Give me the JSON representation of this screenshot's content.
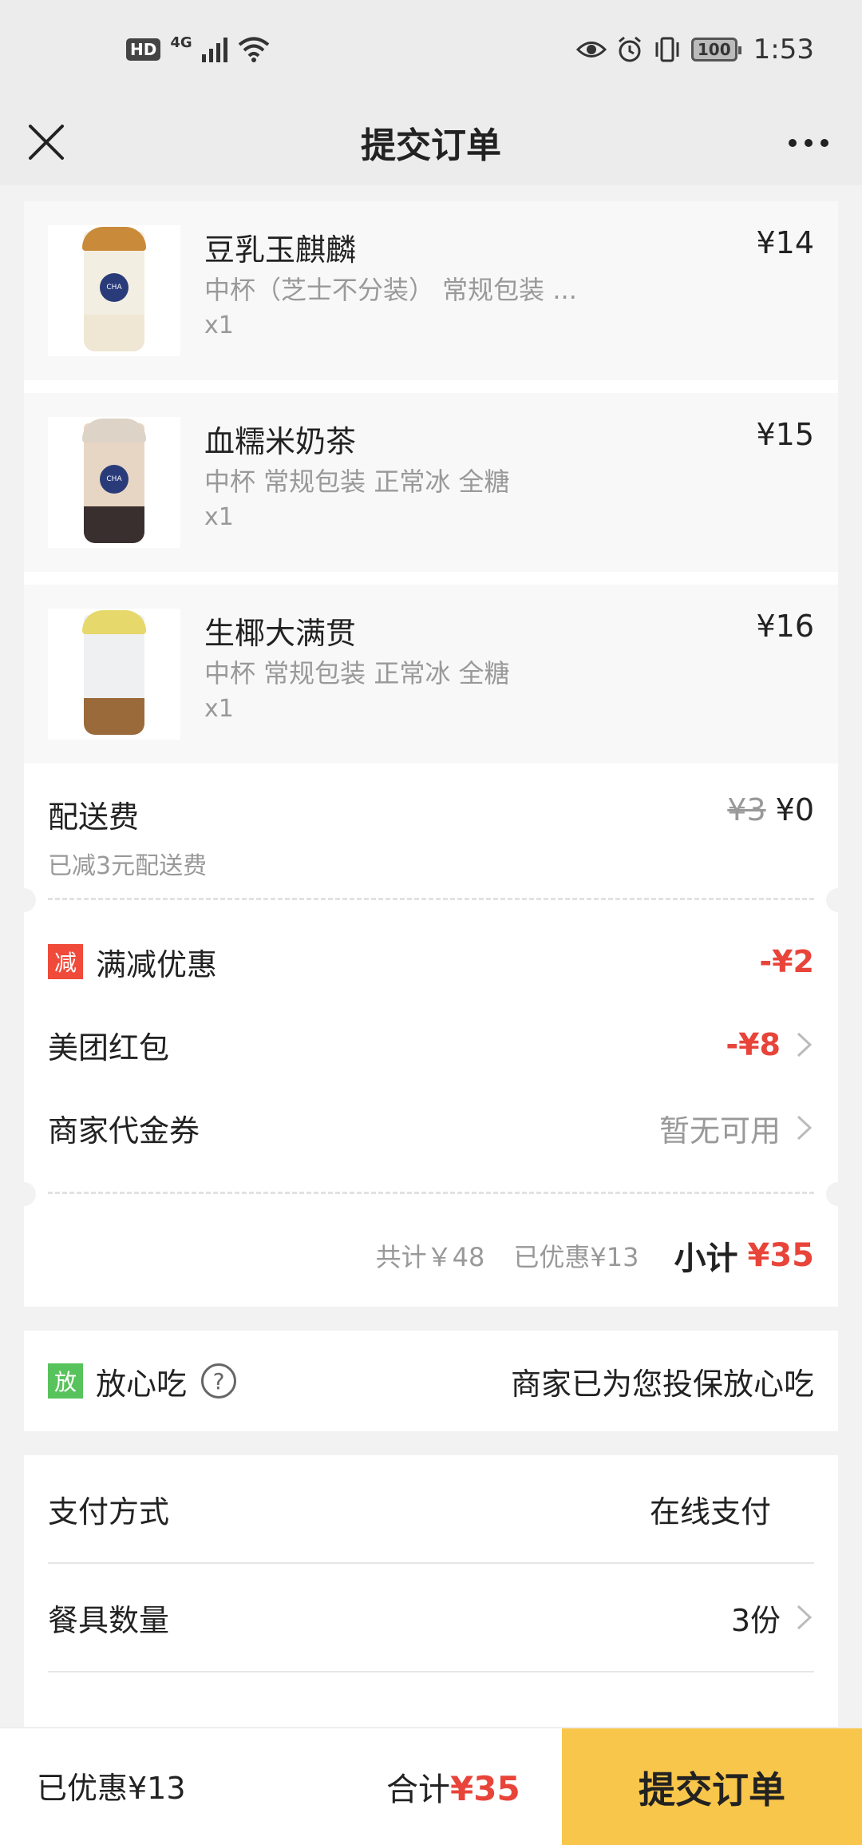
{
  "status_bar": {
    "hd": "HD",
    "network": "4G",
    "battery": "100",
    "time": "1:53",
    "icons": [
      "signal-icon",
      "wifi-icon",
      "eye-icon",
      "alarm-icon",
      "vibrate-icon",
      "battery-icon"
    ]
  },
  "nav": {
    "title": "提交订单",
    "close_icon": "close-icon",
    "more_icon": "more-icon"
  },
  "products": [
    {
      "name": "豆乳玉麒麟",
      "spec": "中杯（芝士不分装） 常规包装 ...",
      "qty": "x1",
      "price": "¥14"
    },
    {
      "name": "血糯米奶茶",
      "spec": "中杯 常规包装 正常冰 全糖",
      "qty": "x1",
      "price": "¥15"
    },
    {
      "name": "生椰大满贯",
      "spec": "中杯 常规包装 正常冰 全糖",
      "qty": "x1",
      "price": "¥16"
    }
  ],
  "delivery": {
    "label": "配送费",
    "sub": "已减3元配送费",
    "original": "¥3",
    "price": "¥0"
  },
  "discounts": {
    "full_reduction": {
      "tag": "减",
      "label": "满减优惠",
      "amount": "-¥2"
    },
    "red_packet": {
      "label": "美团红包",
      "amount": "-¥8"
    },
    "voucher": {
      "label": "商家代金券",
      "value": "暂无可用"
    }
  },
  "subtotal": {
    "total": "共计￥48",
    "saved": "已优惠¥13",
    "label": "小计",
    "amount": "¥35"
  },
  "safe_eat": {
    "tag": "放",
    "label": "放心吃",
    "help": "?",
    "note": "商家已为您投保放心吃"
  },
  "payment": {
    "method_label": "支付方式",
    "method_value": "在线支付",
    "utensils_label": "餐具数量",
    "utensils_value": "3份"
  },
  "bottom_bar": {
    "saved": "已优惠¥13",
    "total_label": "合计",
    "total_amount": "¥35",
    "submit": "提交订单"
  },
  "colors": {
    "accent_red": "#e8443a",
    "submit_yellow": "#f8c64a",
    "tag_green": "#58c35c"
  }
}
